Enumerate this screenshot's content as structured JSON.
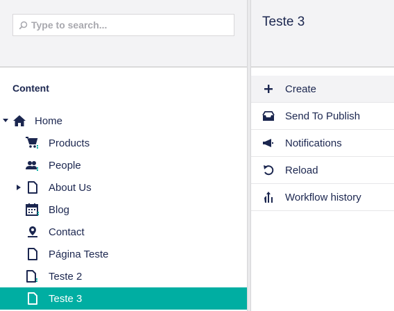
{
  "search": {
    "placeholder": "Type to search..."
  },
  "tree": {
    "section_title": "Content",
    "root": {
      "label": "Home",
      "icon": "home-icon",
      "expanded": true
    },
    "children": [
      {
        "label": "Products",
        "icon": "shopping-cart-icon"
      },
      {
        "label": "People",
        "icon": "users-icon"
      },
      {
        "label": "About Us",
        "icon": "document-icon",
        "has_children": true
      },
      {
        "label": "Blog",
        "icon": "calendar-icon"
      },
      {
        "label": "Contact",
        "icon": "map-pin-icon"
      },
      {
        "label": "Página Teste",
        "icon": "document-icon"
      },
      {
        "label": "Teste 2",
        "icon": "document-icon"
      },
      {
        "label": "Teste 3",
        "icon": "document-icon",
        "selected": true
      }
    ]
  },
  "right": {
    "title": "Teste 3",
    "actions": [
      {
        "label": "Create",
        "icon": "plus-icon"
      },
      {
        "label": "Send To Publish",
        "icon": "publish-icon"
      },
      {
        "label": "Notifications",
        "icon": "megaphone-icon"
      },
      {
        "label": "Reload",
        "icon": "reload-icon"
      },
      {
        "label": "Workflow history",
        "icon": "workflow-icon"
      }
    ]
  },
  "colors": {
    "accent": "#00aea2",
    "text": "#1b264f",
    "header_bg": "#f3f3f5"
  }
}
